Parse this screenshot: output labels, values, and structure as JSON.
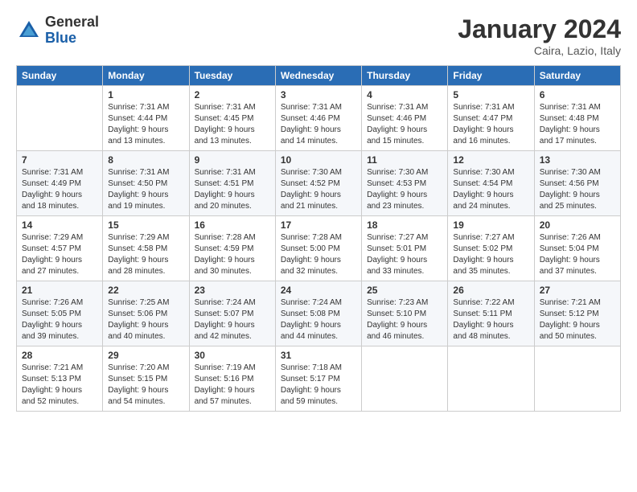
{
  "logo": {
    "general": "General",
    "blue": "Blue"
  },
  "title": "January 2024",
  "location": "Caira, Lazio, Italy",
  "weekdays": [
    "Sunday",
    "Monday",
    "Tuesday",
    "Wednesday",
    "Thursday",
    "Friday",
    "Saturday"
  ],
  "weeks": [
    [
      {
        "day": "",
        "sunrise": "",
        "sunset": "",
        "daylight": ""
      },
      {
        "day": "1",
        "sunrise": "Sunrise: 7:31 AM",
        "sunset": "Sunset: 4:44 PM",
        "daylight": "Daylight: 9 hours and 13 minutes."
      },
      {
        "day": "2",
        "sunrise": "Sunrise: 7:31 AM",
        "sunset": "Sunset: 4:45 PM",
        "daylight": "Daylight: 9 hours and 13 minutes."
      },
      {
        "day": "3",
        "sunrise": "Sunrise: 7:31 AM",
        "sunset": "Sunset: 4:46 PM",
        "daylight": "Daylight: 9 hours and 14 minutes."
      },
      {
        "day": "4",
        "sunrise": "Sunrise: 7:31 AM",
        "sunset": "Sunset: 4:46 PM",
        "daylight": "Daylight: 9 hours and 15 minutes."
      },
      {
        "day": "5",
        "sunrise": "Sunrise: 7:31 AM",
        "sunset": "Sunset: 4:47 PM",
        "daylight": "Daylight: 9 hours and 16 minutes."
      },
      {
        "day": "6",
        "sunrise": "Sunrise: 7:31 AM",
        "sunset": "Sunset: 4:48 PM",
        "daylight": "Daylight: 9 hours and 17 minutes."
      }
    ],
    [
      {
        "day": "7",
        "sunrise": "Sunrise: 7:31 AM",
        "sunset": "Sunset: 4:49 PM",
        "daylight": "Daylight: 9 hours and 18 minutes."
      },
      {
        "day": "8",
        "sunrise": "Sunrise: 7:31 AM",
        "sunset": "Sunset: 4:50 PM",
        "daylight": "Daylight: 9 hours and 19 minutes."
      },
      {
        "day": "9",
        "sunrise": "Sunrise: 7:31 AM",
        "sunset": "Sunset: 4:51 PM",
        "daylight": "Daylight: 9 hours and 20 minutes."
      },
      {
        "day": "10",
        "sunrise": "Sunrise: 7:30 AM",
        "sunset": "Sunset: 4:52 PM",
        "daylight": "Daylight: 9 hours and 21 minutes."
      },
      {
        "day": "11",
        "sunrise": "Sunrise: 7:30 AM",
        "sunset": "Sunset: 4:53 PM",
        "daylight": "Daylight: 9 hours and 23 minutes."
      },
      {
        "day": "12",
        "sunrise": "Sunrise: 7:30 AM",
        "sunset": "Sunset: 4:54 PM",
        "daylight": "Daylight: 9 hours and 24 minutes."
      },
      {
        "day": "13",
        "sunrise": "Sunrise: 7:30 AM",
        "sunset": "Sunset: 4:56 PM",
        "daylight": "Daylight: 9 hours and 25 minutes."
      }
    ],
    [
      {
        "day": "14",
        "sunrise": "Sunrise: 7:29 AM",
        "sunset": "Sunset: 4:57 PM",
        "daylight": "Daylight: 9 hours and 27 minutes."
      },
      {
        "day": "15",
        "sunrise": "Sunrise: 7:29 AM",
        "sunset": "Sunset: 4:58 PM",
        "daylight": "Daylight: 9 hours and 28 minutes."
      },
      {
        "day": "16",
        "sunrise": "Sunrise: 7:28 AM",
        "sunset": "Sunset: 4:59 PM",
        "daylight": "Daylight: 9 hours and 30 minutes."
      },
      {
        "day": "17",
        "sunrise": "Sunrise: 7:28 AM",
        "sunset": "Sunset: 5:00 PM",
        "daylight": "Daylight: 9 hours and 32 minutes."
      },
      {
        "day": "18",
        "sunrise": "Sunrise: 7:27 AM",
        "sunset": "Sunset: 5:01 PM",
        "daylight": "Daylight: 9 hours and 33 minutes."
      },
      {
        "day": "19",
        "sunrise": "Sunrise: 7:27 AM",
        "sunset": "Sunset: 5:02 PM",
        "daylight": "Daylight: 9 hours and 35 minutes."
      },
      {
        "day": "20",
        "sunrise": "Sunrise: 7:26 AM",
        "sunset": "Sunset: 5:04 PM",
        "daylight": "Daylight: 9 hours and 37 minutes."
      }
    ],
    [
      {
        "day": "21",
        "sunrise": "Sunrise: 7:26 AM",
        "sunset": "Sunset: 5:05 PM",
        "daylight": "Daylight: 9 hours and 39 minutes."
      },
      {
        "day": "22",
        "sunrise": "Sunrise: 7:25 AM",
        "sunset": "Sunset: 5:06 PM",
        "daylight": "Daylight: 9 hours and 40 minutes."
      },
      {
        "day": "23",
        "sunrise": "Sunrise: 7:24 AM",
        "sunset": "Sunset: 5:07 PM",
        "daylight": "Daylight: 9 hours and 42 minutes."
      },
      {
        "day": "24",
        "sunrise": "Sunrise: 7:24 AM",
        "sunset": "Sunset: 5:08 PM",
        "daylight": "Daylight: 9 hours and 44 minutes."
      },
      {
        "day": "25",
        "sunrise": "Sunrise: 7:23 AM",
        "sunset": "Sunset: 5:10 PM",
        "daylight": "Daylight: 9 hours and 46 minutes."
      },
      {
        "day": "26",
        "sunrise": "Sunrise: 7:22 AM",
        "sunset": "Sunset: 5:11 PM",
        "daylight": "Daylight: 9 hours and 48 minutes."
      },
      {
        "day": "27",
        "sunrise": "Sunrise: 7:21 AM",
        "sunset": "Sunset: 5:12 PM",
        "daylight": "Daylight: 9 hours and 50 minutes."
      }
    ],
    [
      {
        "day": "28",
        "sunrise": "Sunrise: 7:21 AM",
        "sunset": "Sunset: 5:13 PM",
        "daylight": "Daylight: 9 hours and 52 minutes."
      },
      {
        "day": "29",
        "sunrise": "Sunrise: 7:20 AM",
        "sunset": "Sunset: 5:15 PM",
        "daylight": "Daylight: 9 hours and 54 minutes."
      },
      {
        "day": "30",
        "sunrise": "Sunrise: 7:19 AM",
        "sunset": "Sunset: 5:16 PM",
        "daylight": "Daylight: 9 hours and 57 minutes."
      },
      {
        "day": "31",
        "sunrise": "Sunrise: 7:18 AM",
        "sunset": "Sunset: 5:17 PM",
        "daylight": "Daylight: 9 hours and 59 minutes."
      },
      {
        "day": "",
        "sunrise": "",
        "sunset": "",
        "daylight": ""
      },
      {
        "day": "",
        "sunrise": "",
        "sunset": "",
        "daylight": ""
      },
      {
        "day": "",
        "sunrise": "",
        "sunset": "",
        "daylight": ""
      }
    ]
  ]
}
